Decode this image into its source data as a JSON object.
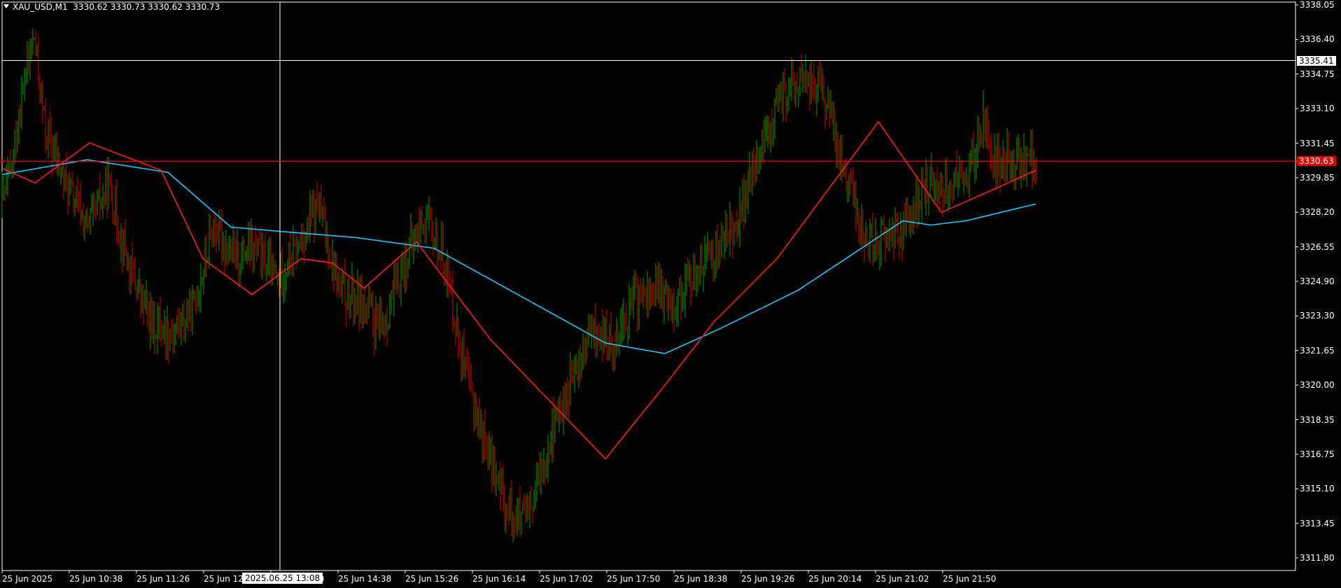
{
  "header": {
    "symbol": "XAU_USD,M1",
    "ohlc": "3330.62 3330.73 3330.62 3330.73"
  },
  "crosshair": {
    "price_label": "3335.41",
    "time_label": "2025.06.25 13:08"
  },
  "bid": {
    "price_label": "3330.63"
  },
  "colors": {
    "background": "#000000",
    "grid": "#ffffff",
    "bull": "#00a000",
    "bear": "#e00000",
    "ma_fast": "#ff1a1a",
    "ma_slow": "#19c8ff",
    "bid_line": "#ff0000"
  },
  "chart_data": {
    "type": "candlestick",
    "ylim": [
      3311.8,
      3338.05
    ],
    "y_ticks": [
      "3338.05",
      "3336.40",
      "3334.75",
      "3333.10",
      "3331.45",
      "3329.85",
      "3328.20",
      "3326.55",
      "3324.90",
      "3323.30",
      "3321.65",
      "3320.00",
      "3318.35",
      "3316.75",
      "3315.10",
      "3313.45",
      "3311.80"
    ],
    "x_ticks": [
      "25 Jun 2025",
      "25 Jun 10:38",
      "25 Jun 11:26",
      "25 Jun 12",
      "25 Jun 13:50",
      "25 Jun 14:38",
      "25 Jun 15:26",
      "25 Jun 16:14",
      "25 Jun 17:02",
      "25 Jun 17:50",
      "25 Jun 18:38",
      "25 Jun 19:26",
      "25 Jun 20:14",
      "25 Jun 21:02",
      "25 Jun 21:50"
    ],
    "price_path": [
      [
        "10:00",
        3331.5
      ],
      [
        "10:10",
        3328.0
      ],
      [
        "10:20",
        3330.0
      ],
      [
        "10:30",
        3334.5
      ],
      [
        "10:37",
        3336.5
      ],
      [
        "10:45",
        3332.0
      ],
      [
        "11:00",
        3329.5
      ],
      [
        "11:15",
        3327.5
      ],
      [
        "11:30",
        3329.5
      ],
      [
        "11:45",
        3325.5
      ],
      [
        "12:00",
        3323.0
      ],
      [
        "12:15",
        3322.5
      ],
      [
        "12:30",
        3323.5
      ],
      [
        "12:45",
        3327.5
      ],
      [
        "13:00",
        3326.0
      ],
      [
        "13:15",
        3326.5
      ],
      [
        "13:30",
        3325.0
      ],
      [
        "13:45",
        3326.5
      ],
      [
        "14:00",
        3328.5
      ],
      [
        "14:15",
        3324.5
      ],
      [
        "14:30",
        3324.0
      ],
      [
        "14:45",
        3322.5
      ],
      [
        "15:00",
        3325.5
      ],
      [
        "15:15",
        3328.0
      ],
      [
        "15:30",
        3326.0
      ],
      [
        "15:45",
        3320.5
      ],
      [
        "16:00",
        3317.0
      ],
      [
        "16:15",
        3314.0
      ],
      [
        "16:30",
        3313.5
      ],
      [
        "16:45",
        3317.5
      ],
      [
        "17:00",
        3320.0
      ],
      [
        "17:15",
        3322.5
      ],
      [
        "17:30",
        3322.0
      ],
      [
        "17:45",
        3324.0
      ],
      [
        "18:00",
        3324.5
      ],
      [
        "18:15",
        3324.0
      ],
      [
        "18:30",
        3325.5
      ],
      [
        "18:45",
        3326.5
      ],
      [
        "19:00",
        3328.0
      ],
      [
        "19:15",
        3331.0
      ],
      [
        "19:30",
        3333.5
      ],
      [
        "19:45",
        3334.5
      ],
      [
        "20:00",
        3334.0
      ],
      [
        "20:15",
        3330.5
      ],
      [
        "20:30",
        3327.0
      ],
      [
        "20:45",
        3327.0
      ],
      [
        "21:00",
        3327.5
      ],
      [
        "21:15",
        3329.5
      ],
      [
        "21:30",
        3329.5
      ],
      [
        "21:45",
        3330.0
      ],
      [
        "21:55",
        3332.5
      ],
      [
        "22:00",
        3330.7
      ]
    ],
    "series": [
      {
        "values": [
          [
            3330.3
          ],
          [
            3329.6
          ],
          [
            3331.5
          ],
          [
            3330.2
          ],
          [
            3326.0
          ],
          [
            3324.3
          ],
          [
            3326.0
          ],
          [
            3325.8
          ],
          [
            3324.6
          ],
          [
            3326.8
          ],
          [
            3322.2
          ],
          [
            3316.5
          ],
          [
            3320.0
          ],
          [
            3323.0
          ],
          [
            3326.0
          ],
          [
            3332.5
          ],
          [
            3328.2
          ],
          [
            3329.3
          ],
          [
            3330.2
          ]
        ]
      },
      {
        "values": [
          [
            3330.0
          ],
          [
            3330.7
          ],
          [
            3330.1
          ],
          [
            3327.5
          ],
          [
            3327.3
          ],
          [
            3327.0
          ],
          [
            3326.5
          ],
          [
            3322.0
          ],
          [
            3321.5
          ],
          [
            3322.7
          ],
          [
            3324.5
          ],
          [
            3327.8
          ],
          [
            3327.6
          ],
          [
            3327.8
          ],
          [
            3328.6
          ]
        ]
      }
    ],
    "bid_price": 3330.63,
    "crosshair_price": 3335.41
  }
}
